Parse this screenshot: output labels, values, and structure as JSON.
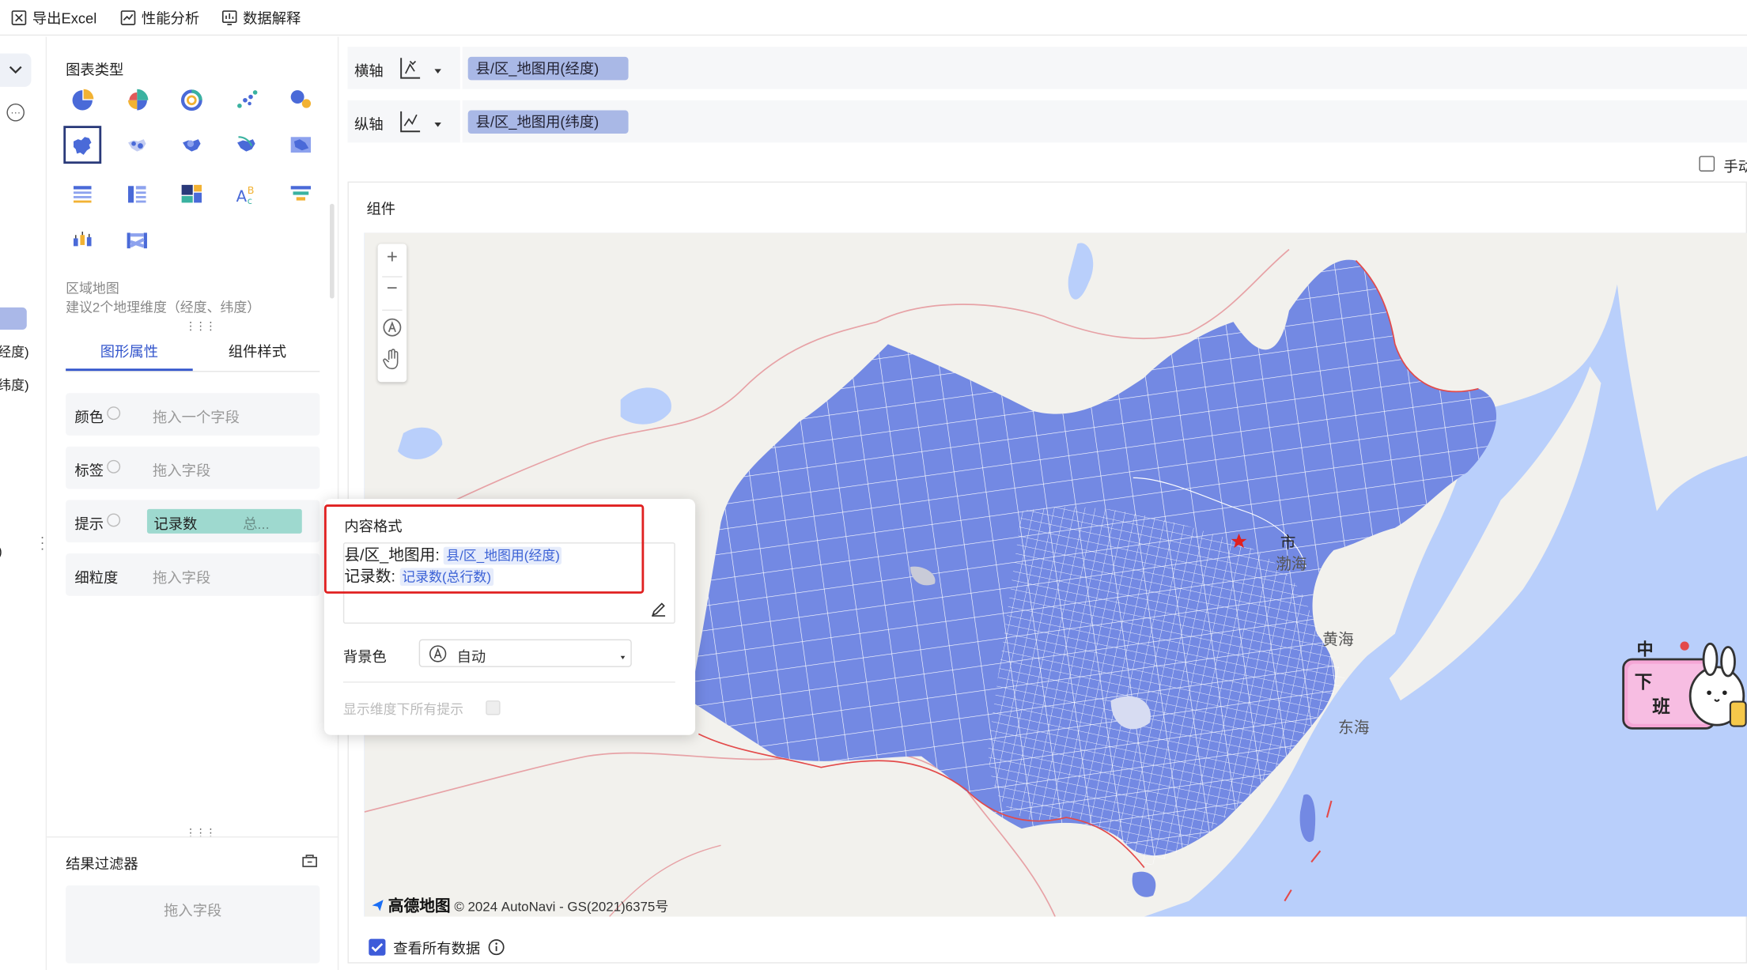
{
  "toolbar": {
    "export_excel": "导出Excel",
    "perf_analysis": "性能分析",
    "data_explain": "数据解释"
  },
  "left_strip": {
    "field_longitude_fragment": "经度)",
    "field_latitude_fragment": "纬度)",
    "fragment_paren": ")"
  },
  "panel": {
    "chart_type_title": "图表类型",
    "selected_chart_name": "区域地图",
    "selected_chart_hint": "建议2个地理维度（经度、纬度）",
    "tabs": [
      "图形属性",
      "组件样式"
    ],
    "active_tab": 0,
    "props": [
      {
        "label": "颜色",
        "placeholder": "拖入一个字段"
      },
      {
        "label": "标签",
        "placeholder": "拖入字段"
      },
      {
        "label": "提示",
        "chip": "记录数",
        "chip_agg": "总..."
      },
      {
        "label": "细粒度",
        "placeholder": "拖入字段"
      }
    ],
    "result_filter_title": "结果过滤器",
    "result_filter_placeholder": "拖入字段"
  },
  "axes": {
    "x_label": "横轴",
    "x_field": "县/区_地图用(经度)",
    "y_label": "纵轴",
    "y_field": "县/区_地图用(纬度)",
    "manual_checkbox_label": "手动"
  },
  "component": {
    "title": "组件",
    "map_labels": {
      "bohai": "渤海",
      "huanghai": "黄海",
      "donghai": "东海",
      "city_fragment": "市"
    },
    "attribution_brand": "高德地图",
    "attribution_text": "© 2024 AutoNavi - GS(2021)6375号",
    "view_all_label": "查看所有数据",
    "view_all_checked": true
  },
  "popover": {
    "title": "内容格式",
    "line1_prefix": "县/区_地图用:",
    "line1_token": "县/区_地图用(经度)",
    "line2_prefix": "记录数:",
    "line2_token": "记录数(总行数)",
    "bg_label": "背景色",
    "bg_value": "自动",
    "show_all_label": "显示维度下所有提示"
  },
  "colors": {
    "accent": "#3355cc",
    "map_fill": "#7389e3",
    "sea": "#b9cffb",
    "land": "#f2f1ed",
    "chip": "#9ed9cf",
    "pill": "#a9b8e6",
    "highlight_border": "#e02020"
  }
}
